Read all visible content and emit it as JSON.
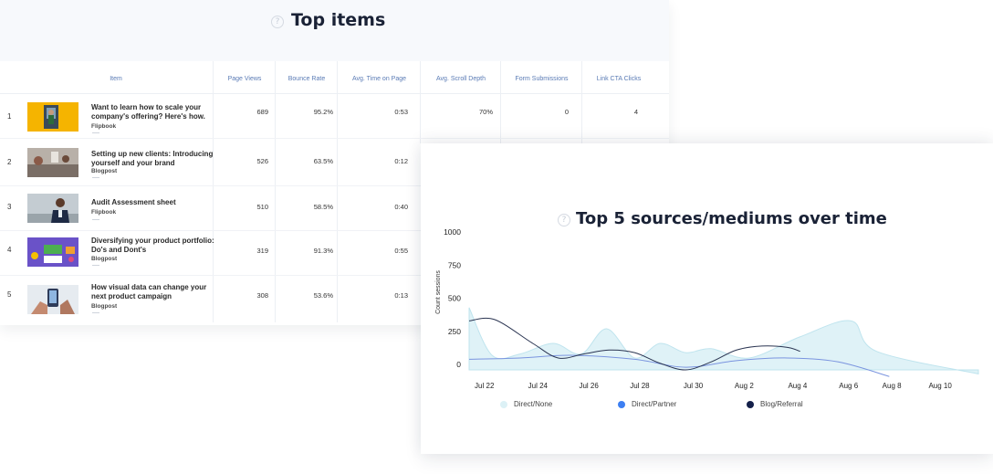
{
  "top_items": {
    "title": "Top items",
    "columns": [
      "Item",
      "Page Views",
      "Bounce Rate",
      "Avg. Time on Page",
      "Avg. Scroll Depth",
      "Form Submissions",
      "Link CTA Clicks"
    ],
    "rows": [
      {
        "rank": "1",
        "title": "Want to learn how to scale your company's offering? Here's how.",
        "type": "Flipbook",
        "page_views": "689",
        "bounce_rate": "95.2%",
        "avg_time": "0:53",
        "scroll_depth": "70%",
        "form_submissions": "0",
        "cta_clicks": "4"
      },
      {
        "rank": "2",
        "title": "Setting up new clients: Introducing yourself and your brand",
        "type": "Blogpost",
        "page_views": "526",
        "bounce_rate": "63.5%",
        "avg_time": "0:12"
      },
      {
        "rank": "3",
        "title": "Audit Assessment sheet",
        "type": "Flipbook",
        "page_views": "510",
        "bounce_rate": "58.5%",
        "avg_time": "0:40"
      },
      {
        "rank": "4",
        "title": "Diversifying your product portfolio: Do's and Dont's",
        "type": "Blogpost",
        "page_views": "319",
        "bounce_rate": "91.3%",
        "avg_time": "0:55"
      },
      {
        "rank": "5",
        "title": "How visual data can change your next product campaign",
        "type": "Blogpost",
        "page_views": "308",
        "bounce_rate": "53.6%",
        "avg_time": "0:13"
      }
    ]
  },
  "sources_chart": {
    "title": "Top 5 sources/mediums over time"
  },
  "chart_data": {
    "type": "area",
    "title": "Top 5 sources/mediums over time",
    "ylabel": "Count sessions",
    "ylim": [
      0,
      1000
    ],
    "yticks": [
      0,
      250,
      500,
      750,
      1000
    ],
    "xticks": [
      "Jul 22",
      "Jul 24",
      "Jul 26",
      "Jul 28",
      "Jul 30",
      "Aug 2",
      "Aug 4",
      "Aug 6",
      "Aug 8",
      "Aug 10"
    ],
    "legend_position": "bottom",
    "series": [
      {
        "name": "Direct/None",
        "style": "area",
        "color": "#dcf1f6",
        "points": [
          [
            0,
            470
          ],
          [
            0.9,
            110
          ],
          [
            2,
            120
          ],
          [
            3.3,
            200
          ],
          [
            4.4,
            120
          ],
          [
            5.4,
            310
          ],
          [
            6.5,
            90
          ],
          [
            7.5,
            200
          ],
          [
            8.5,
            130
          ],
          [
            9.5,
            160
          ],
          [
            11,
            90
          ],
          [
            13,
            250
          ],
          [
            15,
            370
          ],
          [
            16,
            140
          ],
          [
            20,
            -30
          ]
        ]
      },
      {
        "name": "Direct/Partner",
        "style": "line",
        "color": "#7a94df",
        "points": [
          [
            0,
            80
          ],
          [
            2,
            90
          ],
          [
            4,
            110
          ],
          [
            6.5,
            80
          ],
          [
            8.5,
            20
          ],
          [
            10.5,
            70
          ],
          [
            12.5,
            90
          ],
          [
            14.5,
            60
          ],
          [
            16.5,
            -50
          ]
        ]
      },
      {
        "name": "Blog/Referral",
        "style": "line",
        "color": "#2b3552",
        "points": [
          [
            0,
            370
          ],
          [
            1,
            380
          ],
          [
            2.5,
            200
          ],
          [
            3.5,
            90
          ],
          [
            4.5,
            120
          ],
          [
            5.5,
            150
          ],
          [
            6.5,
            130
          ],
          [
            7.5,
            50
          ],
          [
            8.5,
            0
          ],
          [
            9.5,
            60
          ],
          [
            10.5,
            150
          ],
          [
            11.5,
            180
          ],
          [
            12.5,
            170
          ],
          [
            13,
            140
          ]
        ]
      }
    ],
    "legend": [
      {
        "label": "Direct/None",
        "color": "#dcf1f6"
      },
      {
        "label": "Direct/Partner",
        "color": "#3d7ff2"
      },
      {
        "label": "Blog/Referral",
        "color": "#14204a"
      }
    ]
  }
}
